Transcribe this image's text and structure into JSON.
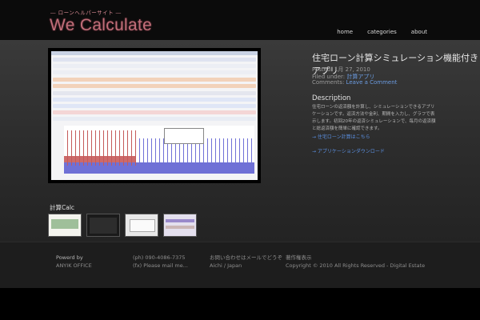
{
  "header": {
    "logo_small": "― ローンヘルパーサイト ―",
    "logo_big": "We Calculate",
    "nav": [
      {
        "label": "home"
      },
      {
        "label": "categories"
      },
      {
        "label": "about"
      }
    ]
  },
  "post": {
    "title": "住宅ローン計算シミュレーション機能付きアプリ",
    "posted": "Posted: 1月 27, 2010",
    "filed_label": "Filed under:",
    "filed_link": "計算アプリ",
    "comments_label": "Comments:",
    "comments_link": "Leave a Comment",
    "description_heading": "Description",
    "description_text": "住宅ローンの返済額を計算し、シミュレーションできるアプリケーションです。返済方法や金利、期間を入力し、グラフで表示します。初回20年の返済シミュレーションで、毎月の返済額と総返済額を簡単に確認できます。",
    "links": [
      "→ 住宅ローン計算はこちら",
      "→ アプリケーションダウンロード"
    ]
  },
  "calc": {
    "title": "計算Calc"
  },
  "footer": {
    "col1": {
      "label": "Powerd by",
      "value": "ANYIK OFFICE"
    },
    "col2": {
      "line1": "(ph) 090-4086-7375",
      "line2": "(fx) Please mail me..."
    },
    "col3": {
      "line1": "お問い合わせはメールでどうぞ",
      "line2": "Aichi / Japan"
    },
    "col4": {
      "line1": "著作権表示",
      "line2": "Copyright © 2010 All Rights Reserved - Digital Estate"
    }
  },
  "colors": {
    "accent_logo": "#c06e79",
    "link_blue": "#6b9be0",
    "chart_red": "#cc6a6a",
    "chart_blue": "#6f70d6"
  }
}
